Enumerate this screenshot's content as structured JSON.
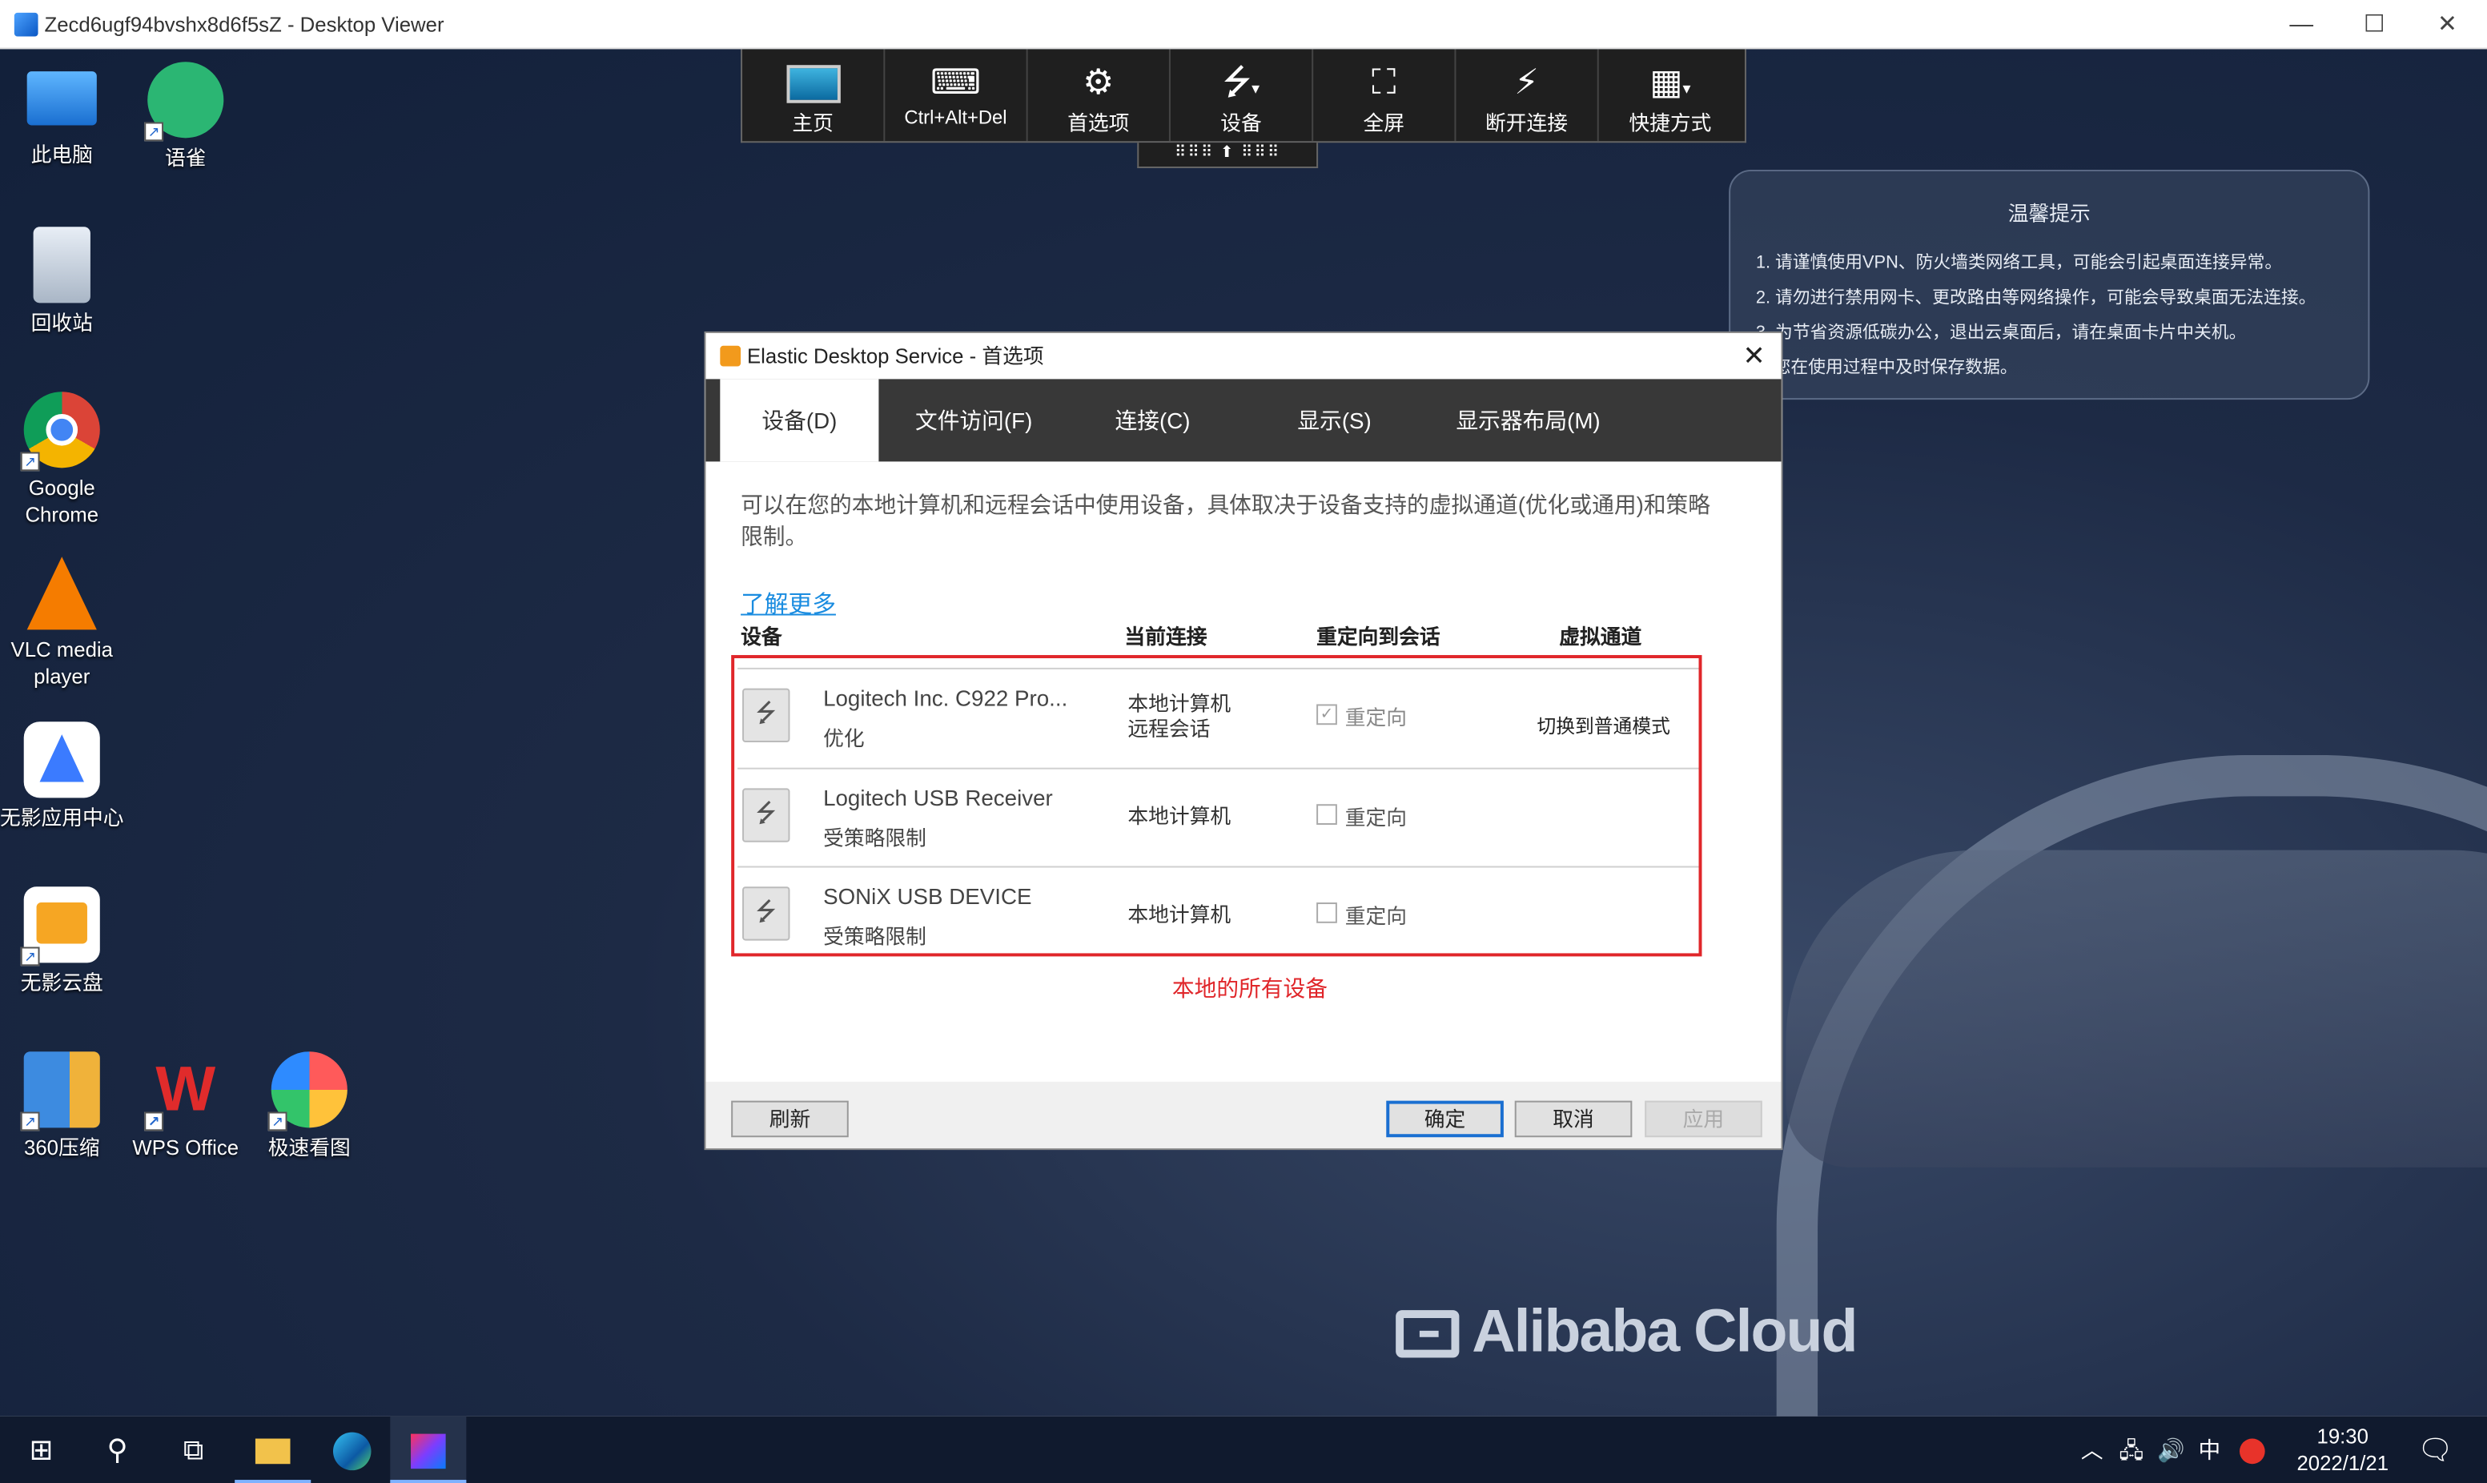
{
  "window": {
    "title": "Zecd6ugf94bvshx8d6f5sZ - Desktop Viewer",
    "minimize": "—",
    "maximize": "☐",
    "close": "✕"
  },
  "desktop_icons": [
    {
      "label": "此电脑"
    },
    {
      "label": "语雀"
    },
    {
      "label": "回收站"
    },
    {
      "label": "Google Chrome"
    },
    {
      "label": "VLC media player"
    },
    {
      "label": "无影应用中心"
    },
    {
      "label": "无影云盘"
    },
    {
      "label": "360压缩"
    },
    {
      "label": "WPS Office"
    },
    {
      "label": "极速看图"
    }
  ],
  "toolbar": {
    "items": [
      {
        "label": "主页"
      },
      {
        "label": "Ctrl+Alt+Del"
      },
      {
        "label": "首选项"
      },
      {
        "label": "设备"
      },
      {
        "label": "全屏"
      },
      {
        "label": "断开连接"
      },
      {
        "label": "快捷方式"
      }
    ],
    "grip": "⠿⠿⠿ ⬆ ⠿⠿⠿"
  },
  "tips": {
    "title": "温馨提示",
    "lines": [
      "1. 请谨慎使用VPN、防火墙类网络工具，可能会引起桌面连接异常。",
      "2. 请勿进行禁用网卡、更改路由等网络操作，可能会导致桌面无法连接。",
      "3. 为节省资源低碳办公，退出云桌面后，请在桌面卡片中关机。",
      "请您在使用过程中及时保存数据。"
    ]
  },
  "dialog": {
    "title": "Elastic Desktop Service - 首选项",
    "close": "✕",
    "tabs": [
      {
        "label": "设备(D)"
      },
      {
        "label": "文件访问(F)"
      },
      {
        "label": "连接(C)"
      },
      {
        "label": "显示(S)"
      },
      {
        "label": "显示器布局(M)"
      }
    ],
    "description": "可以在您的本地计算机和远程会话中使用设备，具体取决于设备支持的虚拟通道(优化或通用)和策略限制。",
    "learn_more": "了解更多",
    "columns": {
      "device": "设备",
      "connection": "当前连接",
      "redirect": "重定向到会话",
      "channel": "虚拟通道"
    },
    "devices": [
      {
        "name": "Logitech Inc. C922 Pro...",
        "status": "优化",
        "conn1": "本地计算机",
        "conn2": "远程会话",
        "redirect": "重定向",
        "checked": true,
        "action": "切换到普通模式"
      },
      {
        "name": "Logitech USB Receiver",
        "status": "受策略限制",
        "conn1": "本地计算机",
        "conn2": "",
        "redirect": "重定向",
        "checked": false,
        "action": ""
      },
      {
        "name": "SONiX USB DEVICE",
        "status": "受策略限制",
        "conn1": "本地计算机",
        "conn2": "",
        "redirect": "重定向",
        "checked": false,
        "action": ""
      }
    ],
    "annotation": "本地的所有设备",
    "buttons": {
      "refresh": "刷新",
      "ok": "确定",
      "cancel": "取消",
      "apply": "应用"
    }
  },
  "brand": {
    "text": "Alibaba Cloud"
  },
  "taskbar": {
    "tray_up": "︿",
    "ime": "中",
    "time": "19:30",
    "date": "2022/1/21"
  }
}
